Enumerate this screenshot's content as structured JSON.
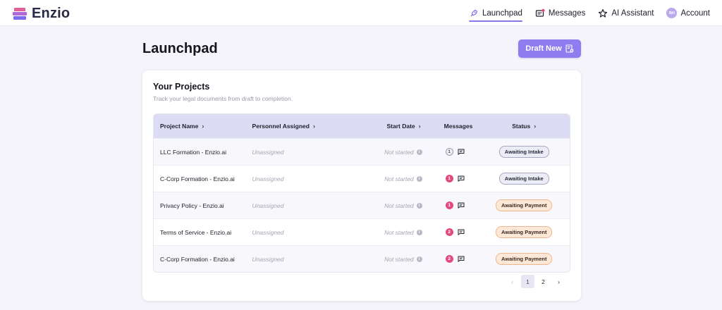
{
  "brand": {
    "name": "Enzio"
  },
  "nav": {
    "items": [
      {
        "label": "Launchpad",
        "icon": "rocket-icon",
        "active": true
      },
      {
        "label": "Messages",
        "icon": "messages-icon",
        "active": false
      },
      {
        "label": "AI Assistant",
        "icon": "star-icon",
        "active": false
      },
      {
        "label": "Account",
        "icon": "avatar",
        "active": false
      }
    ],
    "avatar_initials": "BH"
  },
  "page": {
    "title": "Launchpad",
    "draft_button": "Draft New"
  },
  "projects": {
    "title": "Your Projects",
    "subtitle": "Track your legal documents from draft to completion.",
    "columns": [
      "Project Name",
      "Personnel Assigned",
      "Start Date",
      "Messages",
      "Status"
    ],
    "rows": [
      {
        "name": "LLC Formation - Enzio.ai",
        "personnel": "Unassigned",
        "start": "Not started",
        "messages": "1",
        "messages_unread": false,
        "status": "Awaiting Intake",
        "status_kind": "intake"
      },
      {
        "name": "C-Corp Formation - Enzio.ai",
        "personnel": "Unassigned",
        "start": "Not started",
        "messages": "1",
        "messages_unread": true,
        "status": "Awaiting Intake",
        "status_kind": "intake"
      },
      {
        "name": "Privacy Policy - Enzio.ai",
        "personnel": "Unassigned",
        "start": "Not started",
        "messages": "1",
        "messages_unread": true,
        "status": "Awaiting Payment",
        "status_kind": "payment"
      },
      {
        "name": "Terms of Service - Enzio.ai",
        "personnel": "Unassigned",
        "start": "Not started",
        "messages": "2",
        "messages_unread": true,
        "status": "Awaiting Payment",
        "status_kind": "payment"
      },
      {
        "name": "C-Corp Formation - Enzio.ai",
        "personnel": "Unassigned",
        "start": "Not started",
        "messages": "2",
        "messages_unread": true,
        "status": "Awaiting Payment",
        "status_kind": "payment"
      }
    ]
  },
  "pagination": {
    "pages": [
      "1",
      "2"
    ],
    "current": "1"
  },
  "colors": {
    "accent": "#8f7cee",
    "unread": "#e04a7c",
    "header_row": "#dcdcf4"
  }
}
